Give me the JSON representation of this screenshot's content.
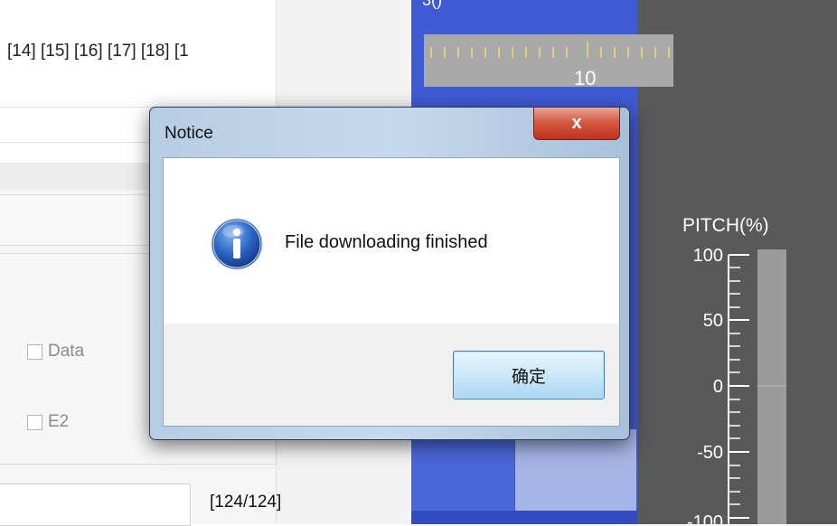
{
  "background_app": {
    "index_line": "[14] [15] [16] [17] [18] [1",
    "checkbox_data_label": "Data",
    "checkbox_e2_label": "E2",
    "counter": "[124/124]"
  },
  "instrument": {
    "top_caption": "3()",
    "ruler_label": "10",
    "pitch": {
      "title": "PITCH(%)",
      "scale_labels": [
        "100",
        "50",
        "0",
        "-50",
        "-100"
      ]
    }
  },
  "dialog": {
    "title": "Notice",
    "close_label": "x",
    "message": "File downloading finished",
    "ok_label": "确定",
    "icon": "info-icon"
  },
  "colors": {
    "instrument_blue": "#3f5bd4",
    "dark_panel": "#595959",
    "close_red": "#c0321b",
    "ok_blue": "#a8d7f2"
  }
}
